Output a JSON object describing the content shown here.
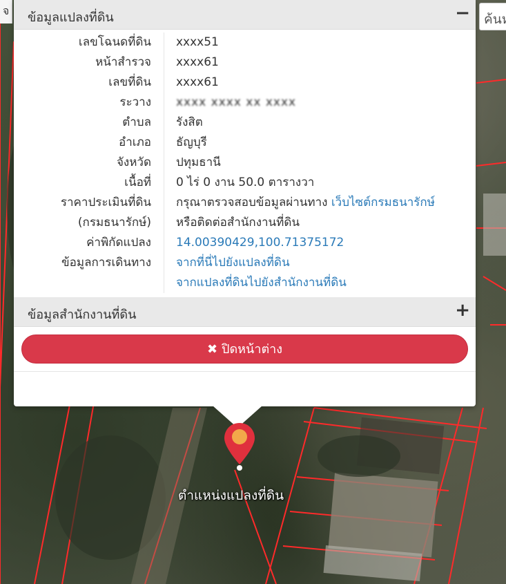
{
  "search": {
    "placeholder": "ค้นห"
  },
  "left_tab": {
    "label": "จ"
  },
  "popup": {
    "parcel_panel": {
      "title": "ข้อมูลแปลงที่ดิน",
      "toggle": "−",
      "rows": [
        {
          "label": "เลขโฉนดที่ดิน",
          "value": "xxxx51"
        },
        {
          "label": "หน้าสำรวจ",
          "value": "xxxx61"
        },
        {
          "label": "เลขที่ดิน",
          "value": "xxxx61"
        },
        {
          "label": "ระวาง",
          "value": "xxxx xxxx xx xxxx"
        },
        {
          "label": "ตำบล",
          "value": "รังสิต"
        },
        {
          "label": "อำเภอ",
          "value": "ธัญบุรี"
        },
        {
          "label": "จังหวัด",
          "value": "ปทุมธานี"
        },
        {
          "label": "เนื้อที่",
          "value": "0 ไร่ 0 งาน 50.0 ตารางวา"
        },
        {
          "label": "ราคาประเมินที่ดิน",
          "value": "กรุณาตรวจสอบข้อมูลผ่านทาง ",
          "link": "เว็บไซต์กรมธนารักษ์"
        },
        {
          "label": "(กรมธนารักษ์)",
          "value": "หรือติดต่อสำนักงานที่ดิน"
        },
        {
          "label": "ค่าพิกัดแปลง",
          "link": "14.00390429,100.71375172"
        },
        {
          "label": "ข้อมูลการเดินทาง",
          "link": "จากที่นี่ไปยังแปลงที่ดิน"
        },
        {
          "label": "",
          "link": "จากแปลงที่ดินไปยังสำนักงานที่ดิน"
        }
      ]
    },
    "office_panel": {
      "title": "ข้อมูลสำนักงานที่ดิน",
      "toggle": "+"
    },
    "close_button": {
      "icon": "✖",
      "label": "ปิดหน้าต่าง"
    }
  },
  "map": {
    "marker_label": "ตำแหน่งแปลงที่ดิน"
  },
  "colors": {
    "accent_red": "#d9394a",
    "link_blue": "#2a7ab8",
    "parcel_line": "#ff2a2a"
  }
}
